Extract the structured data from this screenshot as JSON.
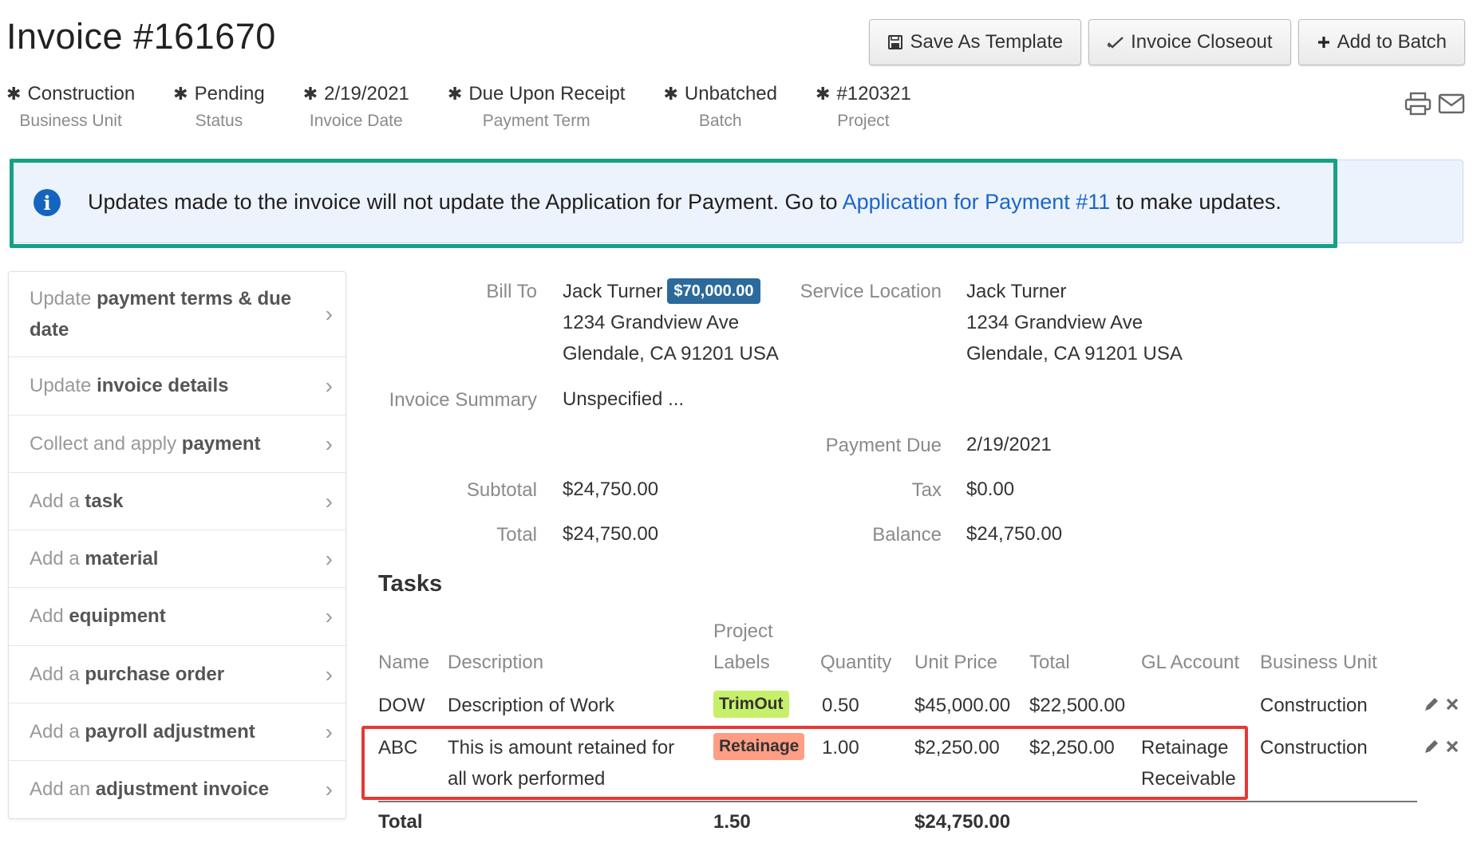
{
  "header": {
    "title": "Invoice #161670",
    "buttons": {
      "save_template": "Save As Template",
      "closeout": "Invoice Closeout",
      "add_batch": "Add to Batch"
    },
    "icons": [
      "print-icon",
      "email-icon"
    ]
  },
  "meta": [
    {
      "value": "Construction",
      "label": "Business Unit"
    },
    {
      "value": "Pending",
      "label": "Status"
    },
    {
      "value": "2/19/2021",
      "label": "Invoice Date"
    },
    {
      "value": "Due Upon Receipt",
      "label": "Payment Term"
    },
    {
      "value": "Unbatched",
      "label": "Batch"
    },
    {
      "value": "#120321",
      "label": "Project"
    }
  ],
  "alert": {
    "text_before": "Updates made to the invoice will not update the Application for Payment. Go to ",
    "link": "Application for Payment #11",
    "text_after": " to make updates."
  },
  "sidebar": {
    "items": [
      {
        "pre": "Update ",
        "bold": "payment terms & due date"
      },
      {
        "pre": "Update ",
        "bold": "invoice details"
      },
      {
        "pre": "Collect and apply ",
        "bold": "payment"
      },
      {
        "pre": "Add a ",
        "bold": "task"
      },
      {
        "pre": "Add a ",
        "bold": "material"
      },
      {
        "pre": "Add ",
        "bold": "equipment"
      },
      {
        "pre": "Add a ",
        "bold": "purchase order"
      },
      {
        "pre": "Add a ",
        "bold": "payroll adjustment"
      },
      {
        "pre": "Add an ",
        "bold": "adjustment invoice"
      }
    ]
  },
  "details": {
    "bill_to_label": "Bill To",
    "bill_to_name": "Jack Turner",
    "bill_to_badge": "$70,000.00",
    "bill_to_addr1": "1234 Grandview Ave",
    "bill_to_addr2": "Glendale, CA 91201 USA",
    "service_location_label": "Service Location",
    "service_name": "Jack Turner",
    "service_addr1": "1234 Grandview Ave",
    "service_addr2": "Glendale, CA 91201 USA",
    "summary_label": "Invoice Summary",
    "summary_value": "Unspecified ...",
    "payment_due_label": "Payment Due",
    "payment_due_value": "2/19/2021",
    "subtotal_label": "Subtotal",
    "subtotal_value": "$24,750.00",
    "tax_label": "Tax",
    "tax_value": "$0.00",
    "total_label": "Total",
    "total_value": "$24,750.00",
    "balance_label": "Balance",
    "balance_value": "$24,750.00"
  },
  "tasks": {
    "title": "Tasks",
    "headers": {
      "name": "Name",
      "description": "Description",
      "labels_top": "Project",
      "labels_bottom": "Labels",
      "quantity": "Quantity",
      "unit_price": "Unit Price",
      "total": "Total",
      "gl_account": "GL Account",
      "business_unit": "Business Unit"
    },
    "rows": [
      {
        "name": "DOW",
        "description": "Description of Work",
        "description2": "",
        "label": "TrimOut",
        "label_color": "#c6f06a",
        "quantity": "0.50",
        "unit_price": "$45,000.00",
        "total": "$22,500.00",
        "gl_account": "",
        "gl_account2": "",
        "business_unit": "Construction"
      },
      {
        "name": "ABC",
        "description": "This is amount retained for",
        "description2": "all work performed",
        "label": "Retainage",
        "label_color": "#ff9e85",
        "quantity": "1.00",
        "unit_price": "$2,250.00",
        "total": "$2,250.00",
        "gl_account": "Retainage",
        "gl_account2": "Receivable",
        "business_unit": "Construction"
      }
    ],
    "footer": {
      "label": "Total",
      "quantity": "1.50",
      "total": "$24,750.00"
    }
  },
  "colors": {
    "highlight_teal": "#16a085",
    "highlight_red": "#e53935",
    "link_blue": "#1a66cc",
    "badge_blue": "#2b6a9b"
  }
}
